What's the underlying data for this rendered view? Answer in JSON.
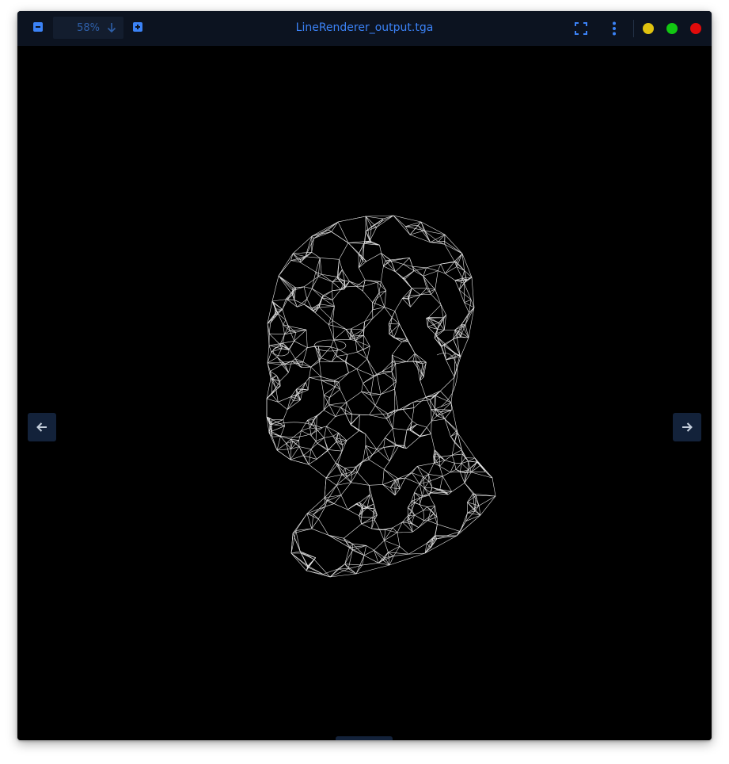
{
  "window": {
    "title": "LineRenderer_output.tga"
  },
  "toolbar": {
    "zoom_out_icon": "minus-square-icon",
    "zoom_in_icon": "plus-square-icon",
    "zoom_level": "58%",
    "zoom_dropdown_icon": "arrow-down-icon",
    "fullscreen_icon": "fullscreen-icon",
    "more_icon": "vertical-dots-icon"
  },
  "window_controls": {
    "minimize_color": "#e0c20f",
    "maximize_color": "#12c712",
    "close_color": "#e00b0b"
  },
  "viewer": {
    "image_description_icon": "wireframe-head-mesh",
    "previous_icon": "arrow-left-icon",
    "next_icon": "arrow-right-icon",
    "rotate_left_icon": "rotate-ccw-icon",
    "rotate_right_icon": "rotate-cw-icon"
  },
  "colors": {
    "accent": "#3b82f6",
    "titlebar_bg": "#0c1320",
    "button_bg": "#13223a",
    "canvas_bg": "#000000",
    "mesh_stroke": "#ffffff"
  }
}
